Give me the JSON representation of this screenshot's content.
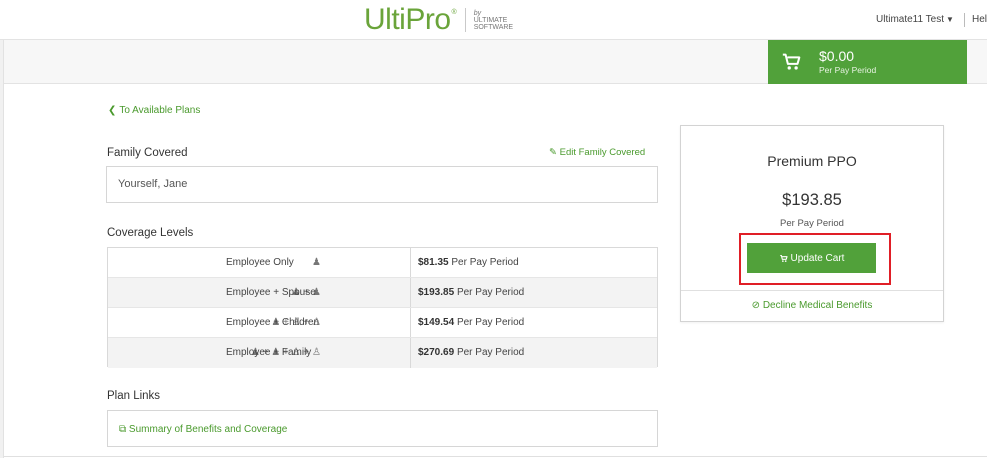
{
  "header": {
    "logo_text": "UltiPro",
    "logo_reg": "®",
    "logo_by": "by",
    "logo_company_1": "ULTIMATE",
    "logo_company_2": "SOFTWARE",
    "user_name": "Ultimate11 Test",
    "help_label": "Help"
  },
  "cart": {
    "amount": "$0.00",
    "period": "Per Pay Period",
    "icon": "cart-icon"
  },
  "nav": {
    "back_label": "To Available Plans"
  },
  "family": {
    "label": "Family Covered",
    "edit_label": "Edit Family Covered",
    "value": "Yourself, Jane"
  },
  "coverage": {
    "label": "Coverage Levels",
    "rows": [
      {
        "icons": "♟",
        "name": "Employee Only",
        "price": "$81.35",
        "period": "Per Pay Period"
      },
      {
        "icons": "♟ + ♟",
        "name": "Employee + Spouse",
        "price": "$193.85",
        "period": "Per Pay Period"
      },
      {
        "icons": "♟ + ♙ + ♙",
        "name": "Employee + Children",
        "price": "$149.54",
        "period": "Per Pay Period"
      },
      {
        "icons": "♟ + ♟ + ♙ + ♙",
        "name": "Employee + Family",
        "price": "$270.69",
        "period": "Per Pay Period"
      }
    ]
  },
  "plan_links": {
    "label": "Plan Links",
    "items": [
      {
        "label": "Summary of Benefits and Coverage"
      }
    ]
  },
  "plan_card": {
    "name": "Premium PPO",
    "price": "$193.85",
    "period": "Per Pay Period",
    "update_label": "Update Cart",
    "decline_label": "Decline Medical Benefits"
  },
  "colors": {
    "accent_green": "#51a13a",
    "link_green": "#4a9a2d",
    "highlight_red": "#e01e26"
  }
}
